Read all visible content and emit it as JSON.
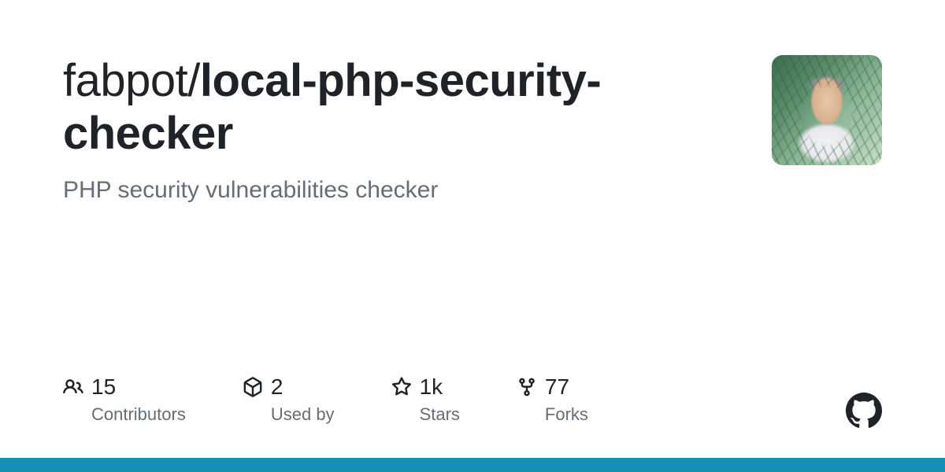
{
  "repo": {
    "owner": "fabpot",
    "separator": "/",
    "name": "local-php-security-checker",
    "description": "PHP security vulnerabilities checker"
  },
  "stats": {
    "contributors": {
      "value": "15",
      "label": "Contributors"
    },
    "usedby": {
      "value": "2",
      "label": "Used by"
    },
    "stars": {
      "value": "1k",
      "label": "Stars"
    },
    "forks": {
      "value": "77",
      "label": "Forks"
    }
  },
  "accent_color": "#1590b3"
}
